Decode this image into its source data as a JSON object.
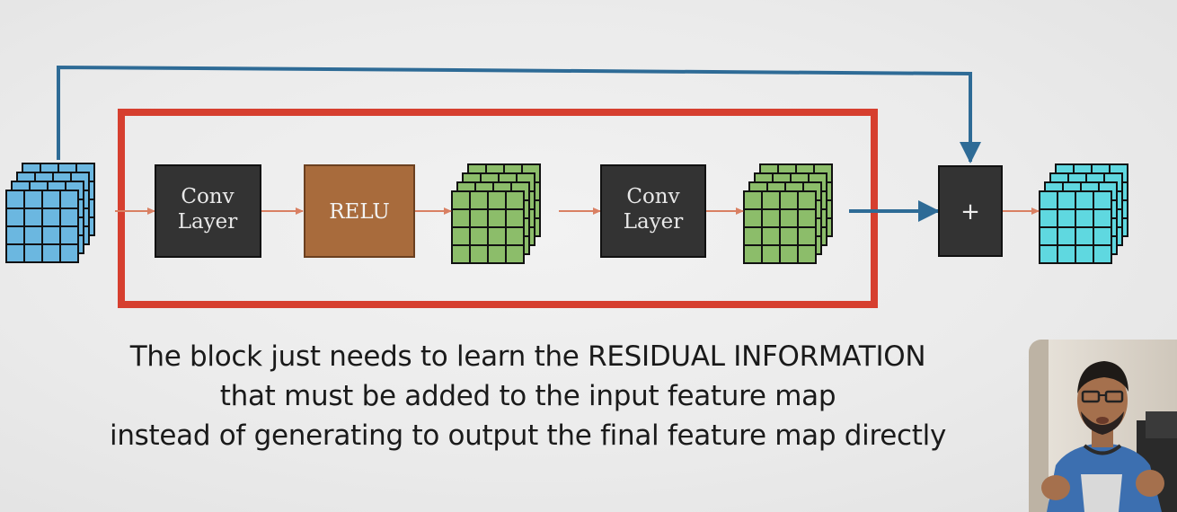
{
  "diagram": {
    "conv1_label": [
      "Conv",
      "Layer"
    ],
    "relu_label": "RELU",
    "conv2_label": [
      "Conv",
      "Layer"
    ],
    "add_label": "+",
    "colors": {
      "input_map": "#6bb7e0",
      "intermediate_map": "#8cbd6a",
      "output_map": "#5fd8e0",
      "block_frame": "#d63f2f",
      "skip_arrow": "#2e6b96",
      "conv_box": "#333333",
      "relu_box": "#a86b3c"
    }
  },
  "caption": {
    "line1": "The block just needs to learn the RESIDUAL INFORMATION",
    "line2": "that must be added to the input feature map",
    "line3": "instead of generating to output the final feature map directly"
  }
}
